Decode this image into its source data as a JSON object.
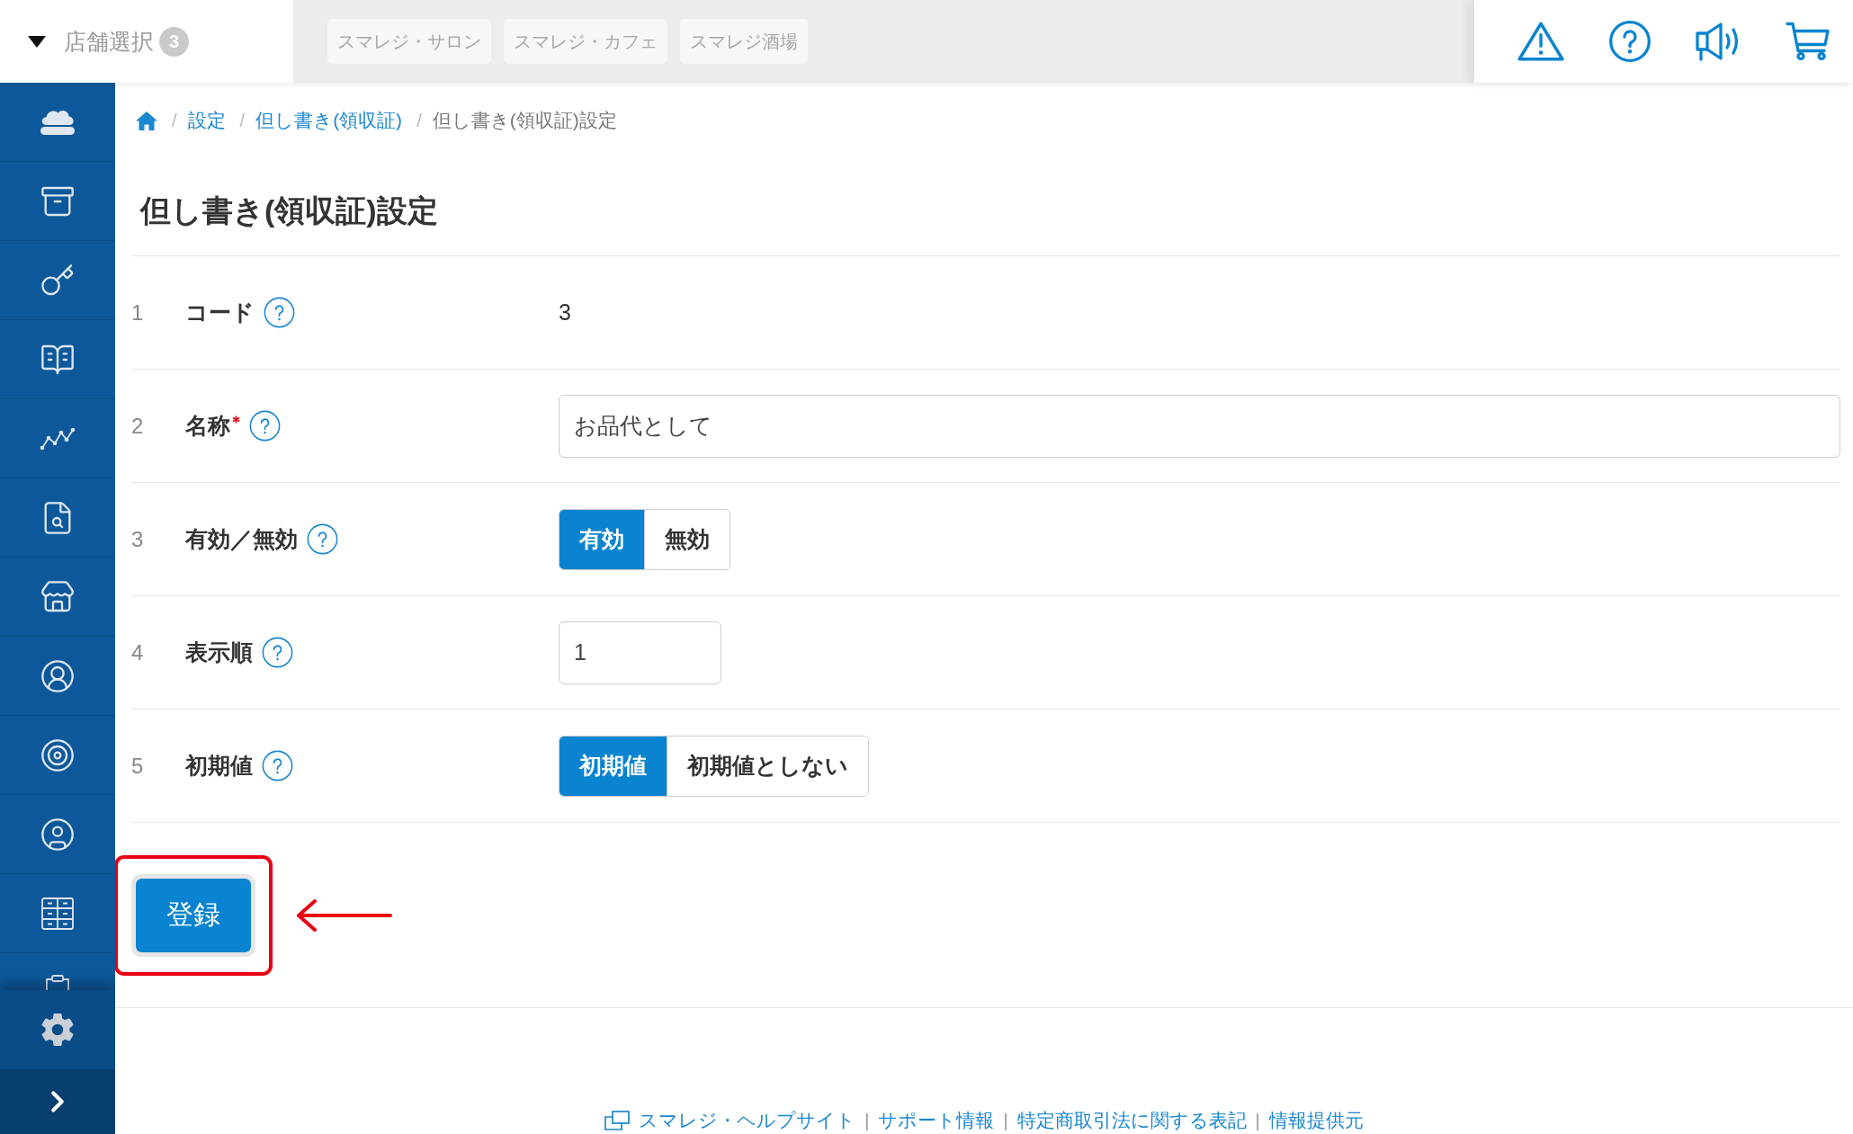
{
  "header": {
    "store_selector": {
      "label": "店舗選択",
      "count": "3"
    },
    "store_tabs": [
      {
        "label": "スマレジ・サロン"
      },
      {
        "label": "スマレジ・カフェ"
      },
      {
        "label": "スマレジ酒場"
      }
    ]
  },
  "breadcrumb": {
    "items": [
      {
        "separator": "/",
        "label": "設定",
        "link": true
      },
      {
        "separator": "/",
        "label": "但し書き(領収証)",
        "link": true
      },
      {
        "separator": "/",
        "label": "但し書き(領収証)設定",
        "link": false
      }
    ]
  },
  "page_title": "但し書き(領収証)設定",
  "form": {
    "rows": [
      {
        "number": "1",
        "label": "コード",
        "required": false,
        "kind": "text",
        "value": "3"
      },
      {
        "number": "2",
        "label": "名称",
        "required": true,
        "kind": "text_input",
        "value": "お品代として"
      },
      {
        "number": "3",
        "label": "有効／無効",
        "required": false,
        "kind": "toggle",
        "options": [
          {
            "label": "有効",
            "selected": true
          },
          {
            "label": "無効",
            "selected": false
          }
        ]
      },
      {
        "number": "4",
        "label": "表示順",
        "required": false,
        "kind": "number_input",
        "value": "1"
      },
      {
        "number": "5",
        "label": "初期値",
        "required": false,
        "kind": "toggle",
        "options": [
          {
            "label": "初期値",
            "selected": true
          },
          {
            "label": "初期値としない",
            "selected": false
          }
        ]
      }
    ]
  },
  "submit_button": {
    "label": "登録",
    "highlighted": true
  },
  "footer": {
    "links": [
      {
        "label": "スマレジ・ヘルプサイト",
        "external": true
      },
      {
        "separator": "|",
        "label": "サポート情報",
        "external": false
      },
      {
        "separator": "|",
        "label": "特定商取引法に関する表記",
        "external": false
      },
      {
        "separator": "|",
        "label": "情報提供元",
        "external": false
      }
    ]
  }
}
